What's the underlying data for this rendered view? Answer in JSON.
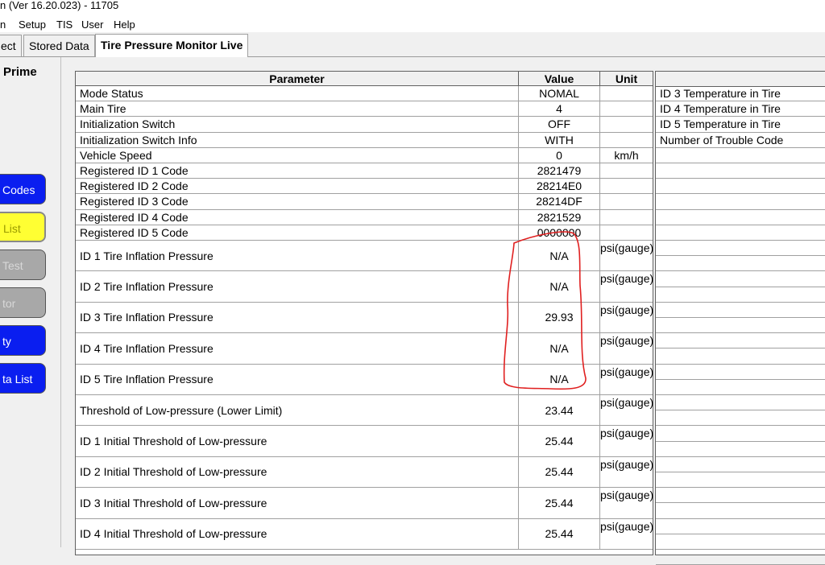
{
  "window": {
    "title": "n (Ver 16.20.023) - 11705"
  },
  "menu": [
    "n",
    "Setup",
    "TIS",
    "User",
    "Help"
  ],
  "tabs": [
    "ect",
    "Stored Data",
    "Tire Pressure Monitor Live"
  ],
  "sidebar": {
    "title": "Prime",
    "buttons": [
      "Codes",
      "List",
      "Test",
      "tor",
      "ty",
      "ta List"
    ]
  },
  "table": {
    "headers": {
      "parameter": "Parameter",
      "value": "Value",
      "unit": "Unit"
    },
    "rows": [
      {
        "parameter": "Mode Status",
        "value": "NOMAL",
        "unit": ""
      },
      {
        "parameter": "Main Tire",
        "value": "4",
        "unit": ""
      },
      {
        "parameter": "Initialization Switch",
        "value": "OFF",
        "unit": ""
      },
      {
        "parameter": "Initialization Switch Info",
        "value": "WITH",
        "unit": ""
      },
      {
        "parameter": "Vehicle Speed",
        "value": "0",
        "unit": "km/h"
      },
      {
        "parameter": "Registered ID 1 Code",
        "value": "2821479",
        "unit": ""
      },
      {
        "parameter": "Registered ID 2 Code",
        "value": "28214E0",
        "unit": ""
      },
      {
        "parameter": "Registered ID 3 Code",
        "value": "28214DF",
        "unit": ""
      },
      {
        "parameter": "Registered ID 4 Code",
        "value": "2821529",
        "unit": ""
      },
      {
        "parameter": "Registered ID 5 Code",
        "value": "0000000",
        "unit": ""
      },
      {
        "parameter": "ID 1 Tire Inflation Pressure",
        "value": "N/A",
        "unit": "psi(gauge)"
      },
      {
        "parameter": "ID 2 Tire Inflation Pressure",
        "value": "N/A",
        "unit": "psi(gauge)"
      },
      {
        "parameter": "ID 3 Tire Inflation Pressure",
        "value": "29.93",
        "unit": "psi(gauge)"
      },
      {
        "parameter": "ID 4 Tire Inflation Pressure",
        "value": "N/A",
        "unit": "psi(gauge)"
      },
      {
        "parameter": "ID 5 Tire Inflation Pressure",
        "value": "N/A",
        "unit": "psi(gauge)"
      },
      {
        "parameter": "Threshold of Low-pressure (Lower Limit)",
        "value": "23.44",
        "unit": "psi(gauge)"
      },
      {
        "parameter": "ID 1 Initial Threshold of Low-pressure",
        "value": "25.44",
        "unit": "psi(gauge)"
      },
      {
        "parameter": "ID 2 Initial Threshold of Low-pressure",
        "value": "25.44",
        "unit": "psi(gauge)"
      },
      {
        "parameter": "ID 3 Initial Threshold of Low-pressure",
        "value": "25.44",
        "unit": "psi(gauge)"
      },
      {
        "parameter": "ID 4 Initial Threshold of Low-pressure",
        "value": "25.44",
        "unit": "psi(gauge)"
      }
    ]
  },
  "side_table": {
    "rows": [
      "ID 3 Temperature in Tire",
      "ID 4 Temperature in Tire",
      "ID 5 Temperature in Tire",
      "Number of Trouble Code"
    ]
  },
  "annotation_color": "#e02020"
}
